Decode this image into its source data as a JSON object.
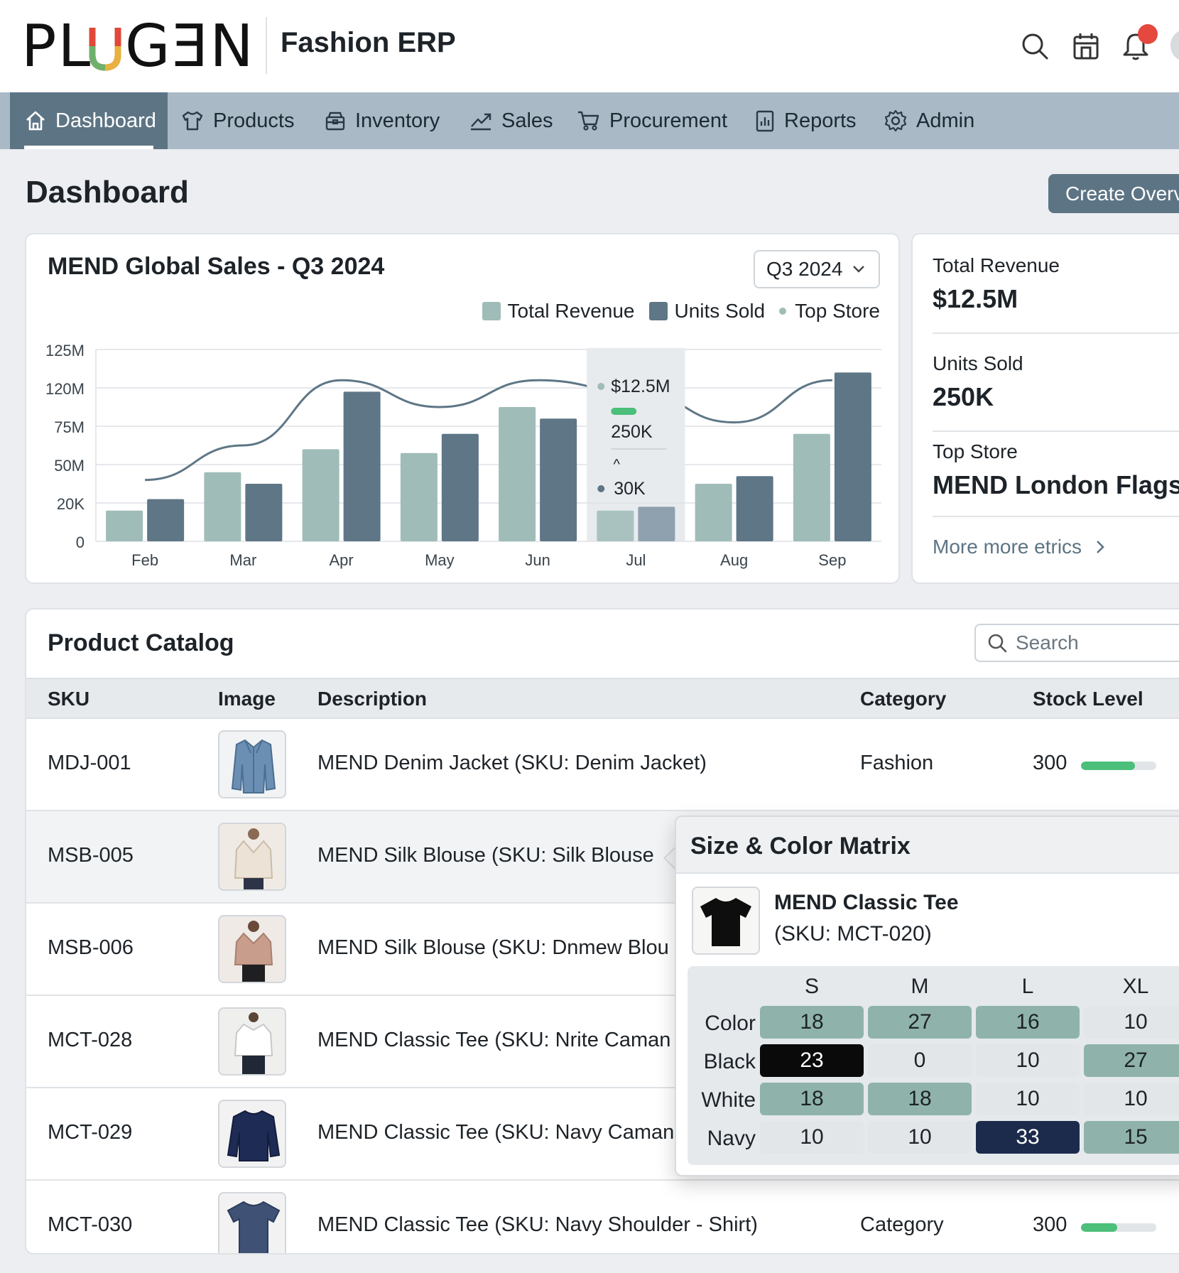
{
  "header": {
    "logo_text": "PLUGEND",
    "app_name": "Fashion ERP",
    "icons": [
      "search-icon",
      "calendar-icon",
      "bell-icon"
    ],
    "has_notification": true
  },
  "nav": {
    "items": [
      {
        "label": "Dashboard",
        "icon": "home-icon",
        "active": true
      },
      {
        "label": "Products",
        "icon": "shirt-icon",
        "active": false
      },
      {
        "label": "Inventory",
        "icon": "box-icon",
        "active": false
      },
      {
        "label": "Sales",
        "icon": "trend-icon",
        "active": false
      },
      {
        "label": "Procurement",
        "icon": "cart-icon",
        "active": false
      },
      {
        "label": "Reports",
        "icon": "report-icon",
        "active": false
      },
      {
        "label": "Admin",
        "icon": "gear-icon",
        "active": false
      }
    ]
  },
  "page": {
    "title": "Dashboard",
    "create_button": "Create Overview"
  },
  "sales_card": {
    "title": "MEND Global Sales - Q3 2024",
    "quarter": "Q3 2024",
    "legend": [
      "Total Revenue",
      "Units Sold",
      "Top Store"
    ],
    "tooltip": {
      "revenue": "$12.5M",
      "units": "250K",
      "caret": "^",
      "store": "30K"
    }
  },
  "chart_data": {
    "type": "bar",
    "categories": [
      "Feb",
      "Mar",
      "Apr",
      "May",
      "Jun",
      "Jul",
      "Aug",
      "Sep"
    ],
    "y_tick_labels": [
      "0",
      "20K",
      "50M",
      "75M",
      "120M",
      "125M"
    ],
    "series": [
      {
        "name": "Total Revenue",
        "type": "bar",
        "values_tick": [
          0.8,
          1.8,
          2.4,
          2.3,
          3.5,
          0.8,
          1.5,
          2.8
        ]
      },
      {
        "name": "Units Sold",
        "type": "bar",
        "values_tick": [
          1.1,
          1.5,
          3.9,
          2.8,
          3.2,
          0.9,
          1.7,
          4.4
        ]
      },
      {
        "name": "Top Store",
        "type": "line",
        "values_tick": [
          1.6,
          2.5,
          4.2,
          3.5,
          4.2,
          3.9,
          3.1,
          4.2
        ]
      }
    ],
    "highlighted_category": "Jul",
    "grid": true,
    "legend_position": "top-right"
  },
  "metrics": [
    {
      "label": "Total Revenue",
      "value": "$12.5M"
    },
    {
      "label": "Units Sold",
      "value": "250K"
    },
    {
      "label": "Top Store",
      "value": "MEND London Flagship"
    }
  ],
  "more_link": "More more etrics",
  "catalog": {
    "title": "Product Catalog",
    "search_placeholder": "Search",
    "columns": [
      "SKU",
      "Image",
      "Description",
      "Category",
      "Stock Level"
    ],
    "rows": [
      {
        "sku": "MDJ-001",
        "image": "denim-jacket-image",
        "description": "MEND Denim Jacket (SKU: Denim Jacket)",
        "category": "Fashion",
        "stock": "300",
        "stock_fraction": 0.72
      },
      {
        "sku": "MSB-005",
        "image": "silk-blouse-cream-image",
        "description": "MEND Silk Blouse (SKU: Silk Blouse",
        "category": "",
        "stock": "",
        "stock_fraction": null
      },
      {
        "sku": "MSB-006",
        "image": "silk-blouse-blush-image",
        "description": "MEND Silk Blouse (SKU: Dnmew Blou",
        "category": "",
        "stock": "",
        "stock_fraction": null
      },
      {
        "sku": "MCT-028",
        "image": "white-shirt-image",
        "description": "MEND Classic Tee (SKU: Nrite Caman",
        "category": "",
        "stock": "",
        "stock_fraction": null
      },
      {
        "sku": "MCT-029",
        "image": "navy-sweater-image",
        "description": "MEND Classic Tee (SKU: Navy Caman",
        "category": "",
        "stock": "",
        "stock_fraction": null
      },
      {
        "sku": "MCT-030",
        "image": "navy-tee-image",
        "description": "MEND Classic Tee (SKU: Navy Shoulder - Shirt)",
        "category": "Category",
        "stock": "300",
        "stock_fraction": 0.48
      }
    ]
  },
  "matrix_popover": {
    "title": "Size & Color Matrix",
    "product_name": "MEND Classic Tee",
    "product_sku": "(SKU: MCT-020)",
    "sizes": [
      "S",
      "M",
      "L",
      "XL"
    ],
    "rows": [
      {
        "label": "Color",
        "cells": [
          {
            "v": "18",
            "lvl": "mid"
          },
          {
            "v": "27",
            "lvl": "mid"
          },
          {
            "v": "16",
            "lvl": "mid"
          },
          {
            "v": "10",
            "lvl": "low"
          }
        ]
      },
      {
        "label": "Black",
        "cells": [
          {
            "v": "23",
            "lvl": "black"
          },
          {
            "v": "0",
            "lvl": "low"
          },
          {
            "v": "10",
            "lvl": "low"
          },
          {
            "v": "27",
            "lvl": "mid"
          }
        ]
      },
      {
        "label": "White",
        "cells": [
          {
            "v": "18",
            "lvl": "mid"
          },
          {
            "v": "18",
            "lvl": "mid"
          },
          {
            "v": "10",
            "lvl": "low"
          },
          {
            "v": "10",
            "lvl": "low"
          }
        ]
      },
      {
        "label": "Navy",
        "cells": [
          {
            "v": "10",
            "lvl": "low"
          },
          {
            "v": "10",
            "lvl": "low"
          },
          {
            "v": "33",
            "lvl": "navy"
          },
          {
            "v": "15",
            "lvl": "mid"
          }
        ]
      }
    ]
  },
  "colors": {
    "accent": "#5d7484",
    "nav_bg": "#a9bac6",
    "revenue_bar": "#9fbcb8",
    "units_bar": "#5e7686",
    "line": "#5e7686",
    "stock_green": "#4cbf7a"
  }
}
